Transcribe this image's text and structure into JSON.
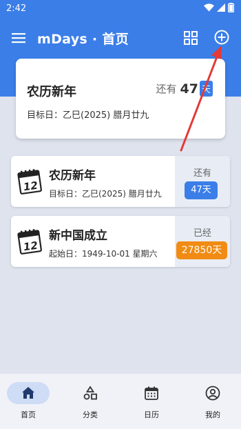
{
  "status_bar": {
    "time": "2:42"
  },
  "app_bar": {
    "title": "mDays · 首页"
  },
  "feature_card": {
    "title": "农历新年",
    "prefix": "还有",
    "days": "47",
    "unit": "天",
    "subtitle": "目标日：乙巳(2025) 腊月廿九"
  },
  "events": [
    {
      "title": "农历新年",
      "subtitle": "目标日：乙巳(2025) 腊月廿九",
      "side_label": "还有",
      "badge": "47天",
      "badge_color": "#3b7ee8"
    },
    {
      "title": "新中国成立",
      "subtitle": "起始日：1949-10-01 星期六",
      "side_label": "已经",
      "badge": "27850天",
      "badge_color": "#f18b13"
    }
  ],
  "bottom_nav": {
    "items": [
      {
        "label": "首页",
        "icon": "home-icon",
        "active": true
      },
      {
        "label": "分类",
        "icon": "category-icon",
        "active": false
      },
      {
        "label": "日历",
        "icon": "calendar-icon",
        "active": false
      },
      {
        "label": "我的",
        "icon": "profile-icon",
        "active": false
      }
    ]
  },
  "colors": {
    "primary": "#3b7ee8",
    "accent_orange": "#f18b13",
    "annotation_red": "#e53935"
  }
}
